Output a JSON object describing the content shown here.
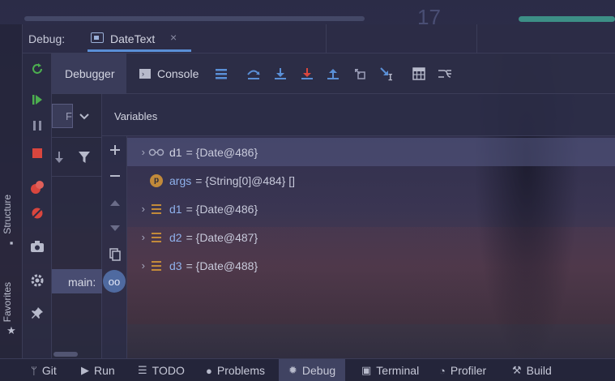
{
  "background": {
    "ghost_number": "17"
  },
  "debug": {
    "label": "Debug:",
    "session_tab": "DateText",
    "close_glyph": "×"
  },
  "toolbar": {
    "tabs": [
      {
        "label": "Debugger",
        "active": true
      },
      {
        "label": "Console",
        "active": false
      }
    ],
    "icons": [
      "layout-icon",
      "step-over-icon",
      "step-into-icon",
      "force-step-into-icon",
      "step-out-icon",
      "drop-frame-icon",
      "run-to-cursor-icon",
      "evaluate-icon",
      "trace-icon"
    ]
  },
  "left_tools": [
    "rerun-icon",
    "resume-icon",
    "pause-icon",
    "stop-icon",
    "view-breakpoints-icon",
    "mute-breakpoints-icon",
    "camera-icon",
    "settings-icon",
    "pin-icon"
  ],
  "frames": {
    "selector_text": "Fr",
    "frame": "main:"
  },
  "variables": {
    "title": "Variables",
    "rows": [
      {
        "expand": "›",
        "kind": "watch",
        "name": "d1",
        "value": "= {Date@486}",
        "selected": true
      },
      {
        "expand": "",
        "kind": "param",
        "name": "args",
        "value": "= {String[0]@484} []",
        "selected": false
      },
      {
        "expand": "›",
        "kind": "field",
        "name": "d1",
        "value": "= {Date@486}",
        "selected": false
      },
      {
        "expand": "›",
        "kind": "field",
        "name": "d2",
        "value": "= {Date@487}",
        "selected": false
      },
      {
        "expand": "›",
        "kind": "field",
        "name": "d3",
        "value": "= {Date@488}",
        "selected": false
      }
    ],
    "param_letter": "p",
    "watch_glyph": "oo"
  },
  "side_tabs": {
    "structure": "Structure",
    "favorites": "Favorites"
  },
  "bottom": {
    "items": [
      {
        "label": "Git",
        "icon": "git-icon"
      },
      {
        "label": "Run",
        "icon": "run-icon"
      },
      {
        "label": "TODO",
        "icon": "todo-icon"
      },
      {
        "label": "Problems",
        "icon": "problems-icon"
      },
      {
        "label": "Debug",
        "icon": "debug-icon",
        "active": true
      },
      {
        "label": "Terminal",
        "icon": "terminal-icon"
      },
      {
        "label": "Profiler",
        "icon": "profiler-icon"
      },
      {
        "label": "Build",
        "icon": "build-icon"
      }
    ]
  },
  "colors": {
    "accent": "#5a8fd6",
    "var_name": "#8fb1ec",
    "field_icon": "#c28a3a",
    "green": "#4cae4f",
    "red": "#d9463e"
  }
}
